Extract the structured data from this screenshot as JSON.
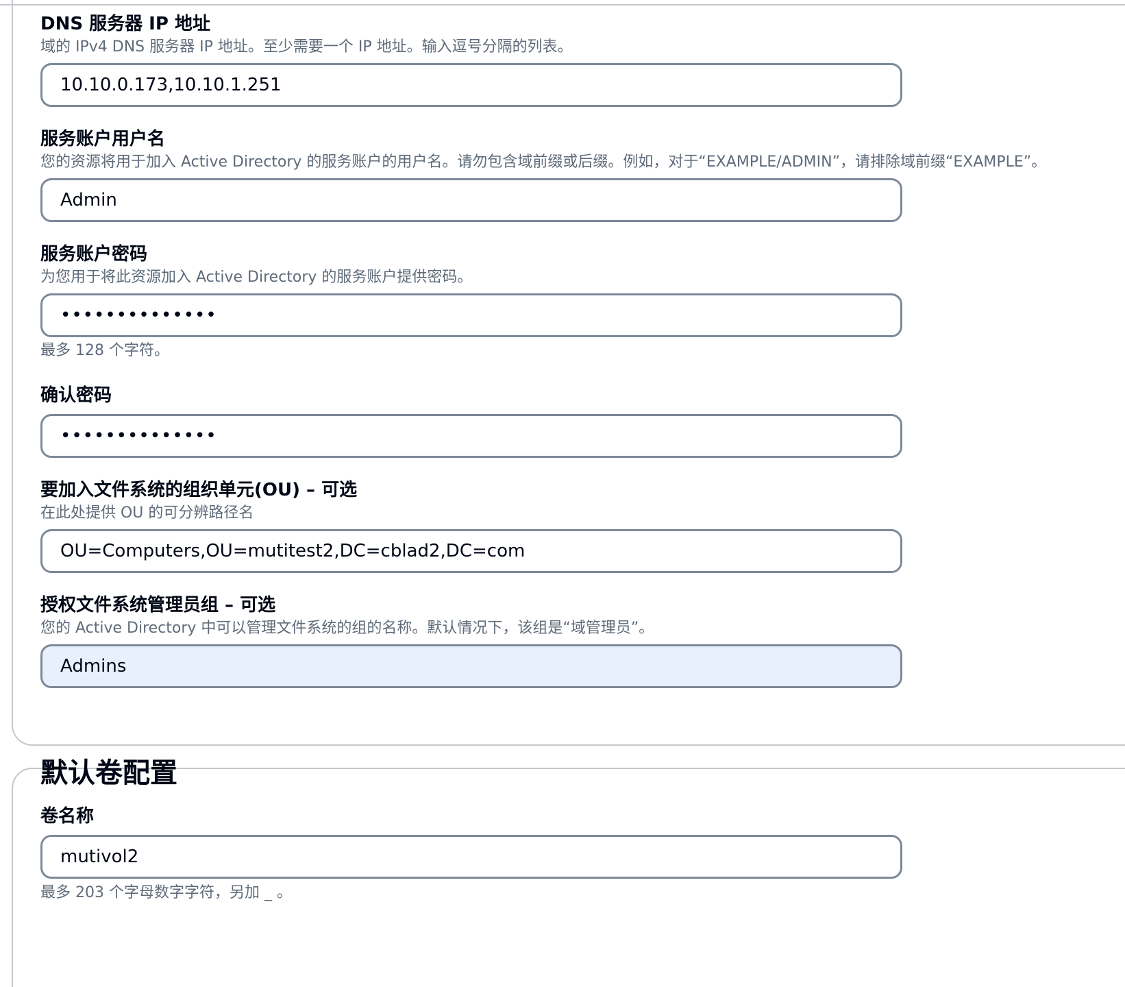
{
  "ad_config": {
    "dns": {
      "label": "DNS 服务器 IP 地址",
      "description": "域的 IPv4 DNS 服务器 IP 地址。至少需要一个 IP 地址。输入逗号分隔的列表。",
      "value": "10.10.0.173,10.10.1.251"
    },
    "username": {
      "label": "服务账户用户名",
      "description": "您的资源将用于加入 Active Directory 的服务账户的用户名。请勿包含域前缀或后缀。例如，对于“EXAMPLE/ADMIN”，请排除域前缀“EXAMPLE”。",
      "value": "Admin"
    },
    "password": {
      "label": "服务账户密码",
      "description": "为您用于将此资源加入 Active Directory 的服务账户提供密码。",
      "value": "••••••••••••••",
      "constraint": "最多 128 个字符。"
    },
    "confirm_password": {
      "label": "确认密码",
      "value": "••••••••••••••"
    },
    "ou": {
      "label": "要加入文件系统的组织单元(OU) – 可选",
      "description": "在此处提供 OU 的可分辨路径名",
      "value": "OU=Computers,OU=mutitest2,DC=cblad2,DC=com"
    },
    "admin_group": {
      "label": "授权文件系统管理员组 – 可选",
      "description": "您的 Active Directory 中可以管理文件系统的组的名称。默认情况下，该组是“域管理员”。",
      "value": "Admins"
    }
  },
  "default_volume": {
    "title": "默认卷配置",
    "volume_name": {
      "label": "卷名称",
      "value": "mutivol2",
      "constraint": "最多 203 个字母数字字符，另加 _ 。"
    }
  }
}
